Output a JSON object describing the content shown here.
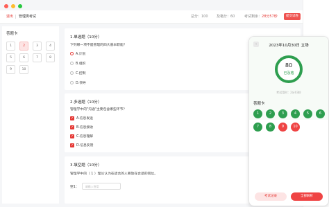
{
  "topbar": {
    "back_label": "退出",
    "title": "管理类考试",
    "total_label": "总分：100",
    "pass_label": "及格分：60",
    "remain_prefix": "考试剩余：",
    "remain_value": "28分57秒",
    "submit_label": "提交试卷"
  },
  "answer_card": {
    "title": "答题卡",
    "items": [
      "1",
      "2",
      "3",
      "4",
      "5",
      "6",
      "7",
      "8",
      "9",
      "10"
    ],
    "current_index": 1
  },
  "questions": {
    "q1": {
      "title": "1.单选题（10分）",
      "text": "下列哪一项不是管理的四大基本职能？",
      "options": [
        "A.计划",
        "B.组织",
        "C.控制",
        "D.领导"
      ],
      "selected": 0
    },
    "q2": {
      "title": "2.多选题（10分）",
      "text": "管理学中的\"沟通\"主要包含哪些环节？",
      "options": [
        "A.信息发送",
        "B.信息接收",
        "C.信息理解",
        "D.信息反馈"
      ],
      "checked": [
        true,
        true,
        true,
        true
      ]
    },
    "q3": {
      "title": "3.填空题（10分）",
      "text": "管理学中的（ 1 ）理论认为在适合的人要放在合适的岗位。",
      "blank_label": "空1：",
      "blank_placeholder": "请输入答案"
    }
  },
  "result": {
    "date": "2023年10月30日 立场",
    "score": "80",
    "status": "已及格",
    "time_used": "考试用时：2分03秒",
    "card_title": "答题卡",
    "balls": [
      {
        "n": "1",
        "ok": true
      },
      {
        "n": "2",
        "ok": true
      },
      {
        "n": "3",
        "ok": true
      },
      {
        "n": "4",
        "ok": true
      },
      {
        "n": "5",
        "ok": true
      },
      {
        "n": "6",
        "ok": true
      },
      {
        "n": "7",
        "ok": true
      },
      {
        "n": "8",
        "ok": true
      },
      {
        "n": "9",
        "ok": false
      },
      {
        "n": "10",
        "ok": false
      }
    ],
    "record_button": "考试记录",
    "analysis_button": "全部解析"
  },
  "colors": {
    "accent_red": "#e53935",
    "correct_green": "#2e9e4f",
    "wrong_red": "#ef4444"
  }
}
